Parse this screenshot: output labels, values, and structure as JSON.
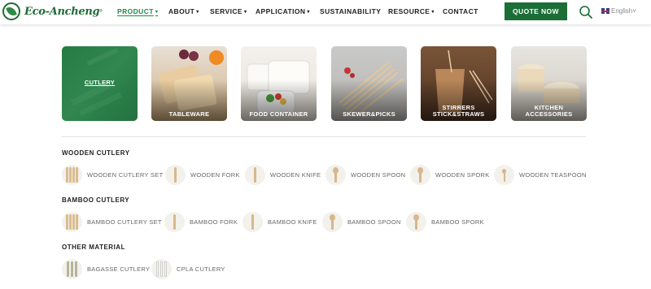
{
  "brand": {
    "name": "Eco-Ancheng",
    "tm": "®"
  },
  "nav": {
    "items": [
      {
        "label": "PRODUCT",
        "caret": "▾",
        "active": true
      },
      {
        "label": "ABOUT",
        "caret": "▾"
      },
      {
        "label": "SERVICE",
        "caret": "▾"
      },
      {
        "label": "APPLICATION",
        "caret": "▾"
      },
      {
        "label": "SUSTAINABILITY",
        "caret": ""
      },
      {
        "label": "RESOURCE",
        "caret": "▾"
      },
      {
        "label": "CONTACT",
        "caret": ""
      }
    ],
    "quote_label": "QUOTE NOW",
    "language": "English",
    "language_caret": "˅"
  },
  "categories": [
    {
      "label": "CUTLERY",
      "active": true
    },
    {
      "label": "TABLEWARE"
    },
    {
      "label": "FOOD CONTAINER"
    },
    {
      "label": "SKEWER&PICKS"
    },
    {
      "label": "STIRRERS STICK&STRAWS"
    },
    {
      "label": "KITCHEN ACCESSORIES"
    }
  ],
  "groups": [
    {
      "title": "WOODEN CUTLERY",
      "products": [
        {
          "name": "WOODEN CUTLERY SET",
          "icon": "cutlery-set-icon"
        },
        {
          "name": "WOODEN FORK",
          "icon": "fork-icon"
        },
        {
          "name": "WOODEN KNIFE",
          "icon": "knife-icon"
        },
        {
          "name": "WOODEN SPOON",
          "icon": "spoon-icon"
        },
        {
          "name": "WOODEN SPORK",
          "icon": "spork-icon"
        },
        {
          "name": "WOODEN TEASPOON",
          "icon": "teaspoon-icon"
        }
      ]
    },
    {
      "title": "BAMBOO CUTLERY",
      "products": [
        {
          "name": "BAMBOO CUTLERY SET",
          "icon": "cutlery-set-icon"
        },
        {
          "name": "BAMBOO FORK",
          "icon": "fork-icon"
        },
        {
          "name": "BAMBOO KNIFE",
          "icon": "knife-icon"
        },
        {
          "name": "BAMBOO SPOON",
          "icon": "spoon-icon"
        },
        {
          "name": "BAMBOO SPORK",
          "icon": "spork-icon"
        }
      ]
    },
    {
      "title": "OTHER MATERIAL",
      "products": [
        {
          "name": "BAGASSE CUTLERY",
          "icon": "cutlery-set-icon"
        },
        {
          "name": "CPLA CUTLERY",
          "icon": "cutlery-set-icon"
        }
      ]
    }
  ],
  "colors": {
    "brand_green": "#1b6e35",
    "active_link": "#1f8c46"
  }
}
